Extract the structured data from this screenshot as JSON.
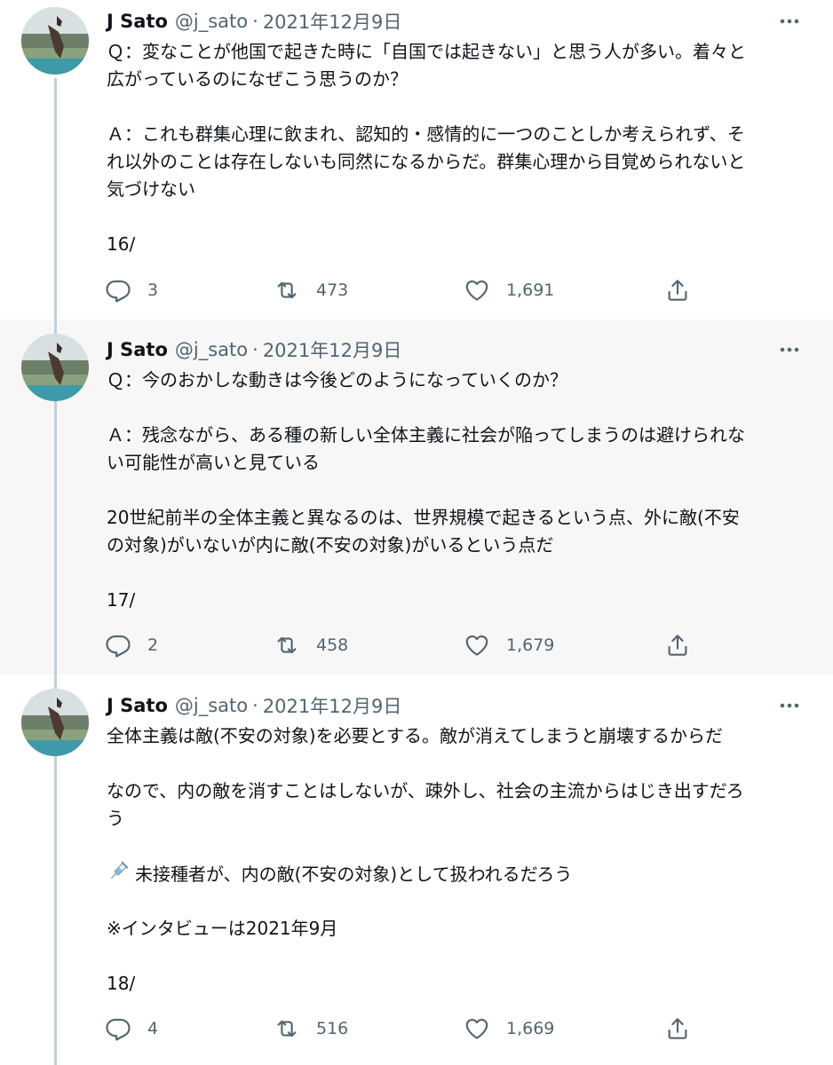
{
  "tweets": [
    {
      "author": "J Sato",
      "handle": "@j_sato",
      "separator": "·",
      "date": "2021年12月9日",
      "lines": [
        "Ｑ：変なことが他国で起きた時に「自国では起きない」と思う人が多い。着々と",
        "広がっているのになぜこう思うのか？",
        "",
        "Ａ：これも群集心理に飲まれ、認知的・感情的に一つのことしか考えられず、そ",
        "れ以外のことは存在しないも同然になるからだ。群集心理から目覚められないと",
        "気づけない",
        "",
        "16/"
      ],
      "replies": "3",
      "retweets": "473",
      "likes": "1,691"
    },
    {
      "author": "J Sato",
      "handle": "@j_sato",
      "separator": "·",
      "date": "2021年12月9日",
      "lines": [
        "Ｑ：今のおかしな動きは今後どのようになっていくのか？",
        "",
        "Ａ：残念ながら、ある種の新しい全体主義に社会が陥ってしまうのは避けられな",
        "い可能性が高いと見ている",
        "",
        "20世紀前半の全体主義と異なるのは、世界規模で起きるという点、外に敵(不安",
        "の対象)がいないが内に敵(不安の対象)がいるという点だ",
        "",
        "17/"
      ],
      "replies": "2",
      "retweets": "458",
      "likes": "1,679"
    },
    {
      "author": "J Sato",
      "handle": "@j_sato",
      "separator": "·",
      "date": "2021年12月9日",
      "lines": [
        "全体主義は敵(不安の対象)を必要とする。敵が消えてしまうと崩壊するからだ",
        "",
        "なので、内の敵を消すことはしないが、疎外し、社会の主流からはじき出すだろ",
        "う",
        "",
        "未接種者が、内の敵(不安の対象)として扱われるだろう",
        "",
        "※インタビューは2021年9月",
        "",
        "18/"
      ],
      "emoji_line_index": 5,
      "emoji_icon": "syringe-icon",
      "replies": "4",
      "retweets": "516",
      "likes": "1,669"
    }
  ],
  "colors": {
    "text": "#0f1419",
    "secondary": "#536471",
    "thread_line": "#c4cfd6",
    "highlight_bg": "#f7f7f7"
  },
  "icons": {
    "reply": "reply-icon",
    "retweet": "retweet-icon",
    "like": "heart-icon",
    "share": "share-icon",
    "more": "more-icon"
  }
}
